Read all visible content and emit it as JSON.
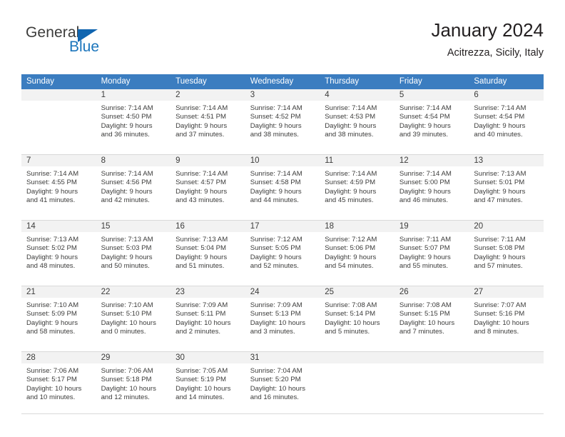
{
  "brand": {
    "name_part1": "General",
    "name_part2": "Blue",
    "triangle_icon": "triangle-icon",
    "accent_color": "#1b75bc"
  },
  "header": {
    "title": "January 2024",
    "subtitle": "Acitrezza, Sicily, Italy"
  },
  "theme": {
    "header_row_bg": "#3b7dc0",
    "day_band_bg": "#f2f2f2",
    "row_divider": "#d9d9d9",
    "text": "#3c3c3b"
  },
  "weekdays": [
    "Sunday",
    "Monday",
    "Tuesday",
    "Wednesday",
    "Thursday",
    "Friday",
    "Saturday"
  ],
  "weeks": [
    [
      {
        "day": "",
        "lines": []
      },
      {
        "day": "1",
        "lines": [
          "Sunrise: 7:14 AM",
          "Sunset: 4:50 PM",
          "Daylight: 9 hours",
          "and 36 minutes."
        ]
      },
      {
        "day": "2",
        "lines": [
          "Sunrise: 7:14 AM",
          "Sunset: 4:51 PM",
          "Daylight: 9 hours",
          "and 37 minutes."
        ]
      },
      {
        "day": "3",
        "lines": [
          "Sunrise: 7:14 AM",
          "Sunset: 4:52 PM",
          "Daylight: 9 hours",
          "and 38 minutes."
        ]
      },
      {
        "day": "4",
        "lines": [
          "Sunrise: 7:14 AM",
          "Sunset: 4:53 PM",
          "Daylight: 9 hours",
          "and 38 minutes."
        ]
      },
      {
        "day": "5",
        "lines": [
          "Sunrise: 7:14 AM",
          "Sunset: 4:54 PM",
          "Daylight: 9 hours",
          "and 39 minutes."
        ]
      },
      {
        "day": "6",
        "lines": [
          "Sunrise: 7:14 AM",
          "Sunset: 4:54 PM",
          "Daylight: 9 hours",
          "and 40 minutes."
        ]
      }
    ],
    [
      {
        "day": "7",
        "lines": [
          "Sunrise: 7:14 AM",
          "Sunset: 4:55 PM",
          "Daylight: 9 hours",
          "and 41 minutes."
        ]
      },
      {
        "day": "8",
        "lines": [
          "Sunrise: 7:14 AM",
          "Sunset: 4:56 PM",
          "Daylight: 9 hours",
          "and 42 minutes."
        ]
      },
      {
        "day": "9",
        "lines": [
          "Sunrise: 7:14 AM",
          "Sunset: 4:57 PM",
          "Daylight: 9 hours",
          "and 43 minutes."
        ]
      },
      {
        "day": "10",
        "lines": [
          "Sunrise: 7:14 AM",
          "Sunset: 4:58 PM",
          "Daylight: 9 hours",
          "and 44 minutes."
        ]
      },
      {
        "day": "11",
        "lines": [
          "Sunrise: 7:14 AM",
          "Sunset: 4:59 PM",
          "Daylight: 9 hours",
          "and 45 minutes."
        ]
      },
      {
        "day": "12",
        "lines": [
          "Sunrise: 7:14 AM",
          "Sunset: 5:00 PM",
          "Daylight: 9 hours",
          "and 46 minutes."
        ]
      },
      {
        "day": "13",
        "lines": [
          "Sunrise: 7:13 AM",
          "Sunset: 5:01 PM",
          "Daylight: 9 hours",
          "and 47 minutes."
        ]
      }
    ],
    [
      {
        "day": "14",
        "lines": [
          "Sunrise: 7:13 AM",
          "Sunset: 5:02 PM",
          "Daylight: 9 hours",
          "and 48 minutes."
        ]
      },
      {
        "day": "15",
        "lines": [
          "Sunrise: 7:13 AM",
          "Sunset: 5:03 PM",
          "Daylight: 9 hours",
          "and 50 minutes."
        ]
      },
      {
        "day": "16",
        "lines": [
          "Sunrise: 7:13 AM",
          "Sunset: 5:04 PM",
          "Daylight: 9 hours",
          "and 51 minutes."
        ]
      },
      {
        "day": "17",
        "lines": [
          "Sunrise: 7:12 AM",
          "Sunset: 5:05 PM",
          "Daylight: 9 hours",
          "and 52 minutes."
        ]
      },
      {
        "day": "18",
        "lines": [
          "Sunrise: 7:12 AM",
          "Sunset: 5:06 PM",
          "Daylight: 9 hours",
          "and 54 minutes."
        ]
      },
      {
        "day": "19",
        "lines": [
          "Sunrise: 7:11 AM",
          "Sunset: 5:07 PM",
          "Daylight: 9 hours",
          "and 55 minutes."
        ]
      },
      {
        "day": "20",
        "lines": [
          "Sunrise: 7:11 AM",
          "Sunset: 5:08 PM",
          "Daylight: 9 hours",
          "and 57 minutes."
        ]
      }
    ],
    [
      {
        "day": "21",
        "lines": [
          "Sunrise: 7:10 AM",
          "Sunset: 5:09 PM",
          "Daylight: 9 hours",
          "and 58 minutes."
        ]
      },
      {
        "day": "22",
        "lines": [
          "Sunrise: 7:10 AM",
          "Sunset: 5:10 PM",
          "Daylight: 10 hours",
          "and 0 minutes."
        ]
      },
      {
        "day": "23",
        "lines": [
          "Sunrise: 7:09 AM",
          "Sunset: 5:11 PM",
          "Daylight: 10 hours",
          "and 2 minutes."
        ]
      },
      {
        "day": "24",
        "lines": [
          "Sunrise: 7:09 AM",
          "Sunset: 5:13 PM",
          "Daylight: 10 hours",
          "and 3 minutes."
        ]
      },
      {
        "day": "25",
        "lines": [
          "Sunrise: 7:08 AM",
          "Sunset: 5:14 PM",
          "Daylight: 10 hours",
          "and 5 minutes."
        ]
      },
      {
        "day": "26",
        "lines": [
          "Sunrise: 7:08 AM",
          "Sunset: 5:15 PM",
          "Daylight: 10 hours",
          "and 7 minutes."
        ]
      },
      {
        "day": "27",
        "lines": [
          "Sunrise: 7:07 AM",
          "Sunset: 5:16 PM",
          "Daylight: 10 hours",
          "and 8 minutes."
        ]
      }
    ],
    [
      {
        "day": "28",
        "lines": [
          "Sunrise: 7:06 AM",
          "Sunset: 5:17 PM",
          "Daylight: 10 hours",
          "and 10 minutes."
        ]
      },
      {
        "day": "29",
        "lines": [
          "Sunrise: 7:06 AM",
          "Sunset: 5:18 PM",
          "Daylight: 10 hours",
          "and 12 minutes."
        ]
      },
      {
        "day": "30",
        "lines": [
          "Sunrise: 7:05 AM",
          "Sunset: 5:19 PM",
          "Daylight: 10 hours",
          "and 14 minutes."
        ]
      },
      {
        "day": "31",
        "lines": [
          "Sunrise: 7:04 AM",
          "Sunset: 5:20 PM",
          "Daylight: 10 hours",
          "and 16 minutes."
        ]
      },
      {
        "day": "",
        "lines": []
      },
      {
        "day": "",
        "lines": []
      },
      {
        "day": "",
        "lines": []
      }
    ]
  ]
}
